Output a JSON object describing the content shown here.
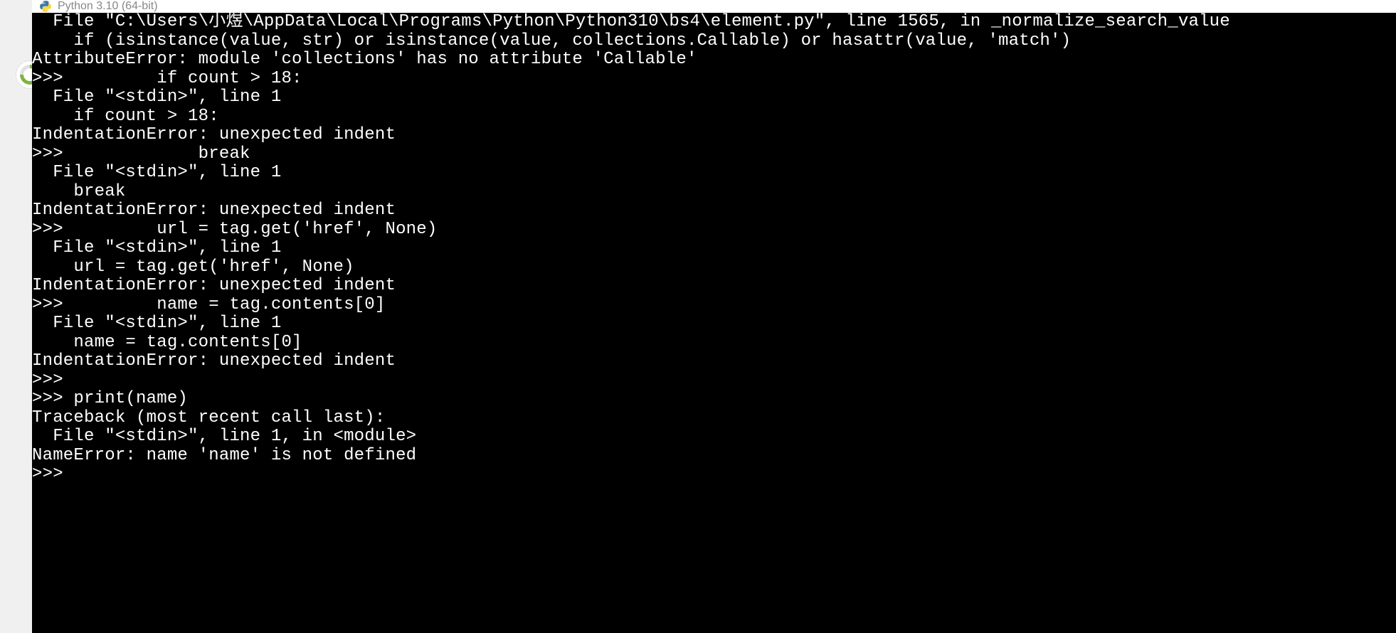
{
  "window": {
    "title": "Python 3.10 (64-bit)"
  },
  "terminal": {
    "lines": [
      "  File \"C:\\Users\\小煜\\AppData\\Local\\Programs\\Python\\Python310\\bs4\\element.py\", line 1565, in _normalize_search_value",
      "    if (isinstance(value, str) or isinstance(value, collections.Callable) or hasattr(value, 'match')",
      "AttributeError: module 'collections' has no attribute 'Callable'",
      ">>>         if count > 18:",
      "  File \"<stdin>\", line 1",
      "    if count > 18:",
      "IndentationError: unexpected indent",
      ">>>             break",
      "  File \"<stdin>\", line 1",
      "    break",
      "IndentationError: unexpected indent",
      ">>>         url = tag.get('href', None)",
      "  File \"<stdin>\", line 1",
      "    url = tag.get('href', None)",
      "IndentationError: unexpected indent",
      ">>>         name = tag.contents[0]",
      "  File \"<stdin>\", line 1",
      "    name = tag.contents[0]",
      "IndentationError: unexpected indent",
      ">>>",
      ">>> print(name)",
      "Traceback (most recent call last):",
      "  File \"<stdin>\", line 1, in <module>",
      "NameError: name 'name' is not defined",
      ">>>"
    ]
  }
}
